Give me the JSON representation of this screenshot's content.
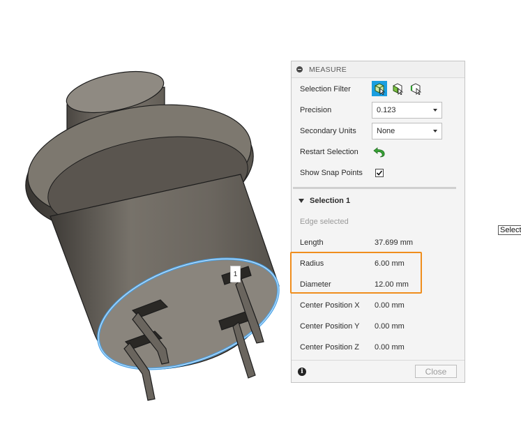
{
  "panel": {
    "title": "MEASURE",
    "selection_filter_label": "Selection Filter",
    "precision_label": "Precision",
    "precision_value": "0.123",
    "secondary_units_label": "Secondary Units",
    "secondary_units_value": "None",
    "restart_selection_label": "Restart Selection",
    "show_snap_points_label": "Show Snap Points",
    "show_snap_points_checked": true
  },
  "selection": {
    "heading": "Selection 1",
    "status": "Edge selected",
    "rows": [
      {
        "label": "Length",
        "value": "37.699 mm"
      },
      {
        "label": "Radius",
        "value": "6.00 mm"
      },
      {
        "label": "Diameter",
        "value": "12.00 mm"
      },
      {
        "label": "Center Position X",
        "value": "0.00 mm"
      },
      {
        "label": "Center Position Y",
        "value": "0.00 mm"
      },
      {
        "label": "Center Position Z",
        "value": "0.00 mm"
      }
    ]
  },
  "footer": {
    "info_icon_glyph": "i",
    "close_label": "Close"
  },
  "viewport": {
    "edge_marker": "1",
    "tooltip": "Select"
  },
  "icons": {
    "filter_body": "body-select-icon",
    "filter_face": "face-select-icon",
    "filter_edge": "edge-select-icon",
    "restart": "restart-arrow-icon",
    "info": "info-icon",
    "collapse": "collapse-icon"
  },
  "colors": {
    "accent": "#1a9ee0",
    "highlight": "#ef8d1c",
    "selected_edge": "#4aa3e8",
    "model": "#6e6a63"
  }
}
